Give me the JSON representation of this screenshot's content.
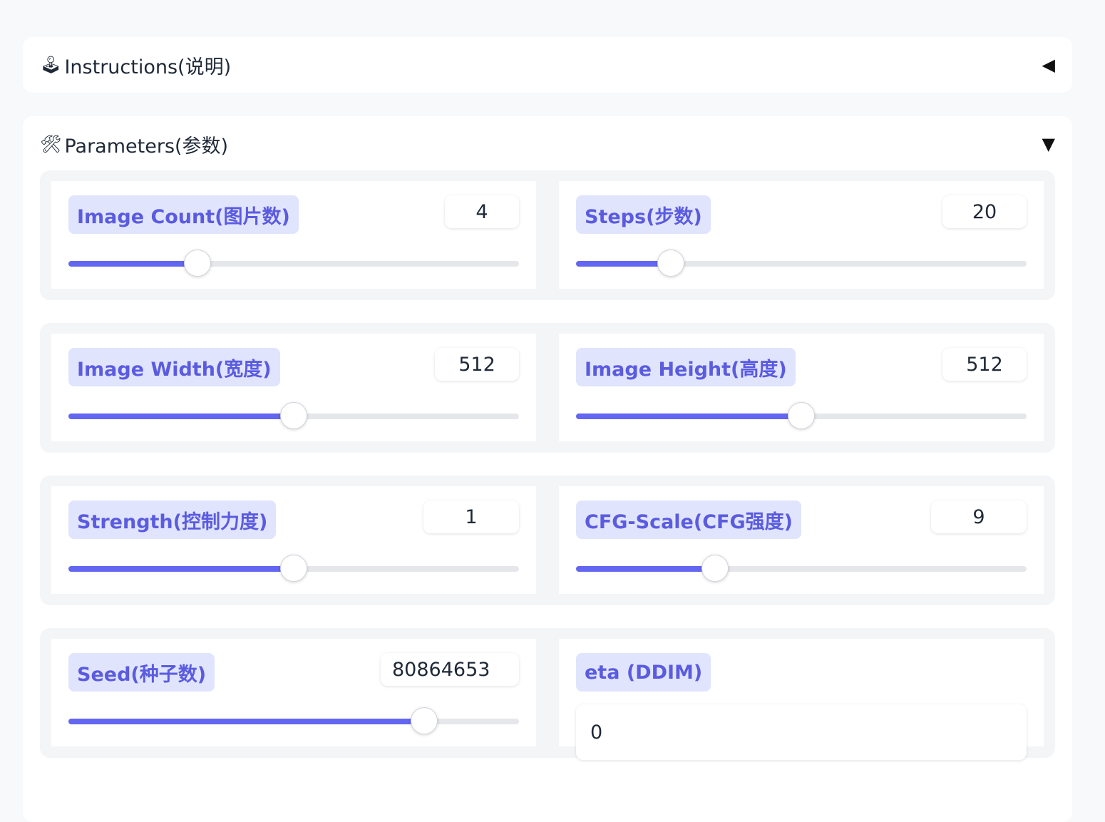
{
  "instructions": {
    "icon": "🕹",
    "icon_name": "joystick-icon",
    "title": "Instructions(说明)",
    "toggle": "◀",
    "expanded": false
  },
  "parameters": {
    "icon": "🛠",
    "icon_name": "hammer-wrench-icon",
    "title": "Parameters(参数)",
    "toggle": "▼",
    "expanded": true
  },
  "colors": {
    "accent": "#6366f1",
    "chip_bg": "#e0e5fd",
    "chip_text": "#5b5be0"
  },
  "controls": {
    "image_count": {
      "label": "Image Count(图片数)",
      "value": "4",
      "fraction": 0.286
    },
    "steps": {
      "label": "Steps(步数)",
      "value": "20",
      "fraction": 0.211
    },
    "image_width": {
      "label": "Image Width(宽度)",
      "value": "512",
      "fraction": 0.5
    },
    "image_height": {
      "label": "Image Height(高度)",
      "value": "512",
      "fraction": 0.5
    },
    "strength": {
      "label": "Strength(控制力度)",
      "value": "1",
      "fraction": 0.5
    },
    "cfg_scale": {
      "label": "CFG-Scale(CFG强度)",
      "value": "9",
      "fraction": 0.308
    },
    "seed": {
      "label": "Seed(种子数)",
      "value": "80864653",
      "fraction": 0.79
    },
    "eta": {
      "label": "eta (DDIM)",
      "value": "0"
    }
  }
}
